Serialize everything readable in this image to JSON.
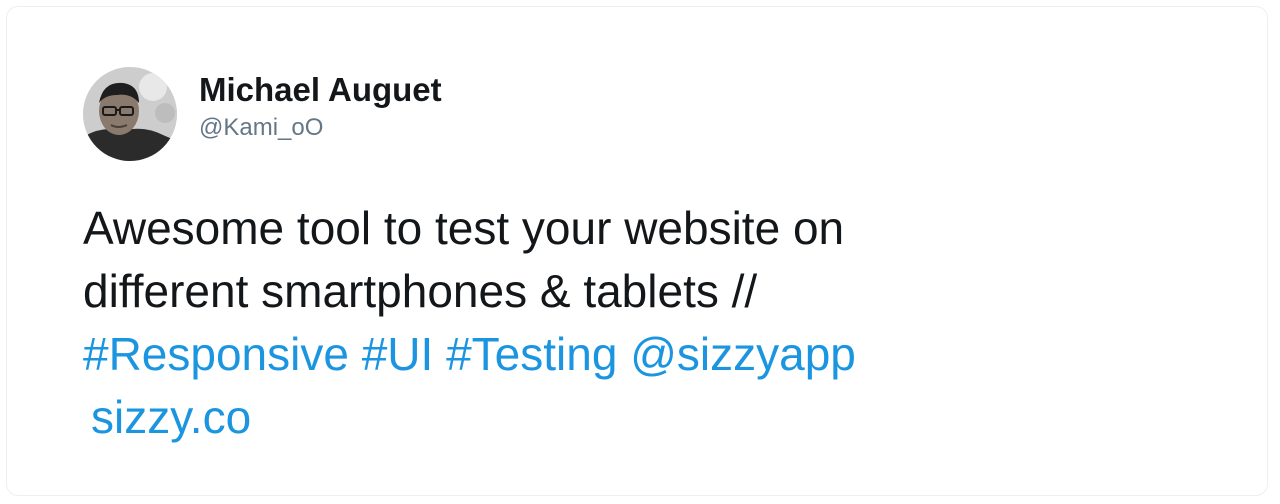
{
  "author": {
    "name": "Michael Auguet",
    "handle": "@Kami_oO",
    "avatar_icon": "person-avatar-icon"
  },
  "tweet": {
    "line1": "Awesome tool to test your website on",
    "line2": "different smartphones & tablets //",
    "hashtags": [
      "#Responsive",
      "#UI",
      "#Testing"
    ],
    "mention": "@sizzyapp",
    "url": "sizzy.co"
  },
  "colors": {
    "text": "#14171a",
    "muted": "#657786",
    "link": "#1b95e0"
  }
}
